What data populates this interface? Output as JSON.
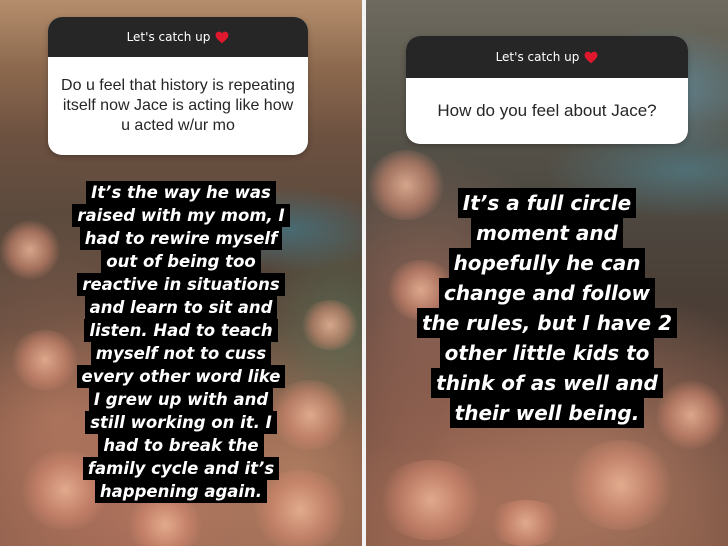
{
  "panels": [
    {
      "card": {
        "title": "Let's catch up",
        "question": "Do u feel that history is repeating itself now Jace is acting like how u acted w/ur mo"
      },
      "answer_lines": [
        "It’s the way he was",
        "raised with my mom, I",
        "had to rewire myself",
        "out of being too",
        "reactive in situations",
        "and learn to sit and",
        "listen. Had to teach",
        "myself not to cuss",
        "every other word like",
        "I grew up with and",
        "still working on it. I",
        "had to break the",
        "family cycle and it’s",
        "happening again."
      ]
    },
    {
      "card": {
        "title": "Let's catch up",
        "question": "How do you feel about Jace?"
      },
      "answer_lines": [
        "It’s a full circle",
        "moment and",
        "hopefully he can",
        "change and follow",
        "the rules, but I have 2",
        "other little kids to",
        "think of as well and",
        "their well being."
      ]
    }
  ],
  "icons": {
    "heart": "heart-icon"
  },
  "colors": {
    "heart": "#e0182d",
    "card_header": "#262626",
    "highlight": "#000000"
  }
}
